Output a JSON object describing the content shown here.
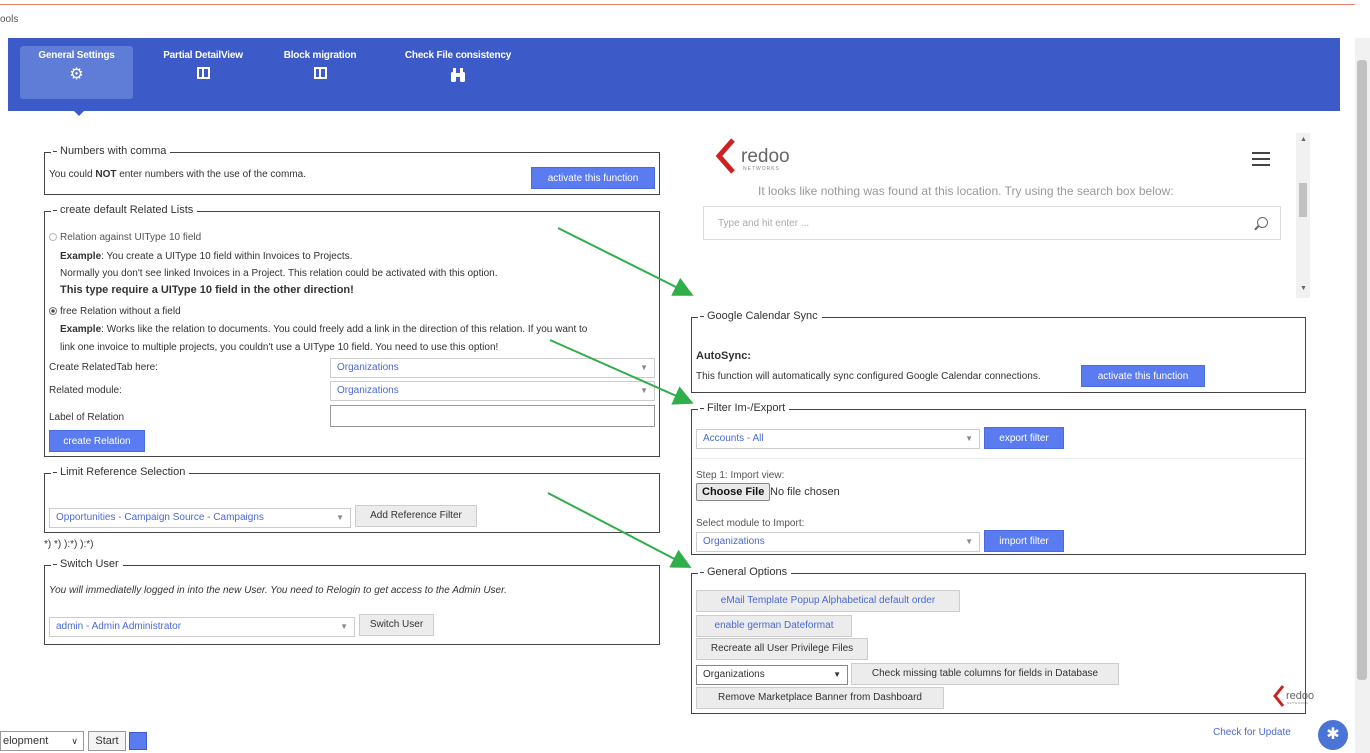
{
  "breadcrumb": "ools",
  "nav": {
    "tabs": [
      {
        "label": "General Settings",
        "icon": "gears-icon",
        "active": true
      },
      {
        "label": "Partial DetailView",
        "icon": "columns-icon",
        "active": false
      },
      {
        "label": "Block migration",
        "icon": "columns-icon",
        "active": false
      },
      {
        "label": "Check File consistency",
        "icon": "binoculars-icon",
        "active": false
      }
    ]
  },
  "numbers_comma": {
    "legend": "Numbers with comma",
    "text_pre": "You could ",
    "text_bold": "NOT",
    "text_post": " enter numbers with the use of the comma.",
    "button": "activate this function"
  },
  "related_lists": {
    "legend": "create default Related Lists",
    "option1_label": "Relation against UIType 10 field",
    "ex1_title": "Example",
    "ex1_line1": ": You create a UIType 10 field within Invoices to Projects.",
    "ex1_line2": "Normally you don't see linked Invoices in a Project. This relation could be activated with this option.",
    "ex1_line3": "This type require a UIType 10 field in the other direction!",
    "option2_label": "free Relation without a field",
    "ex2_title": "Example",
    "ex2_line1": ": Works like the relation to documents. You could freely add a link in the direction of this relation. If you want to",
    "ex2_line2": "link one invoice to multiple projects, you couldn't use a UIType 10 field. You need to use this option!",
    "tab_label": "Create RelatedTab here:",
    "tab_value": "Organizations",
    "module_label": "Related module:",
    "module_value": "Organizations",
    "relation_label": "Label of Relation",
    "button": "create Relation"
  },
  "limit_ref": {
    "legend": "Limit Reference Selection",
    "select_value": "Opportunities - Campaign Source - Campaigns",
    "button": "Add Reference Filter"
  },
  "stray_text": "*) *) ):*) ):*)",
  "switch_user": {
    "legend": "Switch User",
    "text": "You will immediatelly logged in into the new User. You need to Relogin to get access to the Admin User.",
    "select_value": "admin - Admin Administrator",
    "button": "Switch User"
  },
  "embedded": {
    "logo": "redoo",
    "logo_sub": "NETWORKS",
    "not_found": "It looks like nothing was found at this location. Try using the search box below:",
    "search_placeholder": "Type and hit enter ..."
  },
  "gcal": {
    "legend": "Google Calendar Sync",
    "heading": "AutoSync:",
    "text": "This function will automatically sync configured Google Calendar connections.",
    "button": "activate this function"
  },
  "filter": {
    "legend": "Filter Im-/Export",
    "export_select": "Accounts - All",
    "export_button": "export filter",
    "step1_label": "Step 1: Import view:",
    "file_button": "Choose File",
    "file_status": "No file chosen",
    "module_label": "Select module to Import:",
    "module_select": "Organizations",
    "import_button": "import filter"
  },
  "general": {
    "legend": "General Options",
    "btn_email": "eMail Template Popup Alphabetical default order",
    "btn_german": "enable german Dateformat",
    "btn_privilege": "Recreate all User Privilege Files",
    "module_select": "Organizations",
    "btn_missing": "Check missing table columns for fields in Database",
    "btn_banner": "Remove Marketplace Banner from Dashboard"
  },
  "footer": {
    "env_select": "elopment",
    "start_button": "Start",
    "check_update": "Check for Update"
  },
  "colors": {
    "nav_bg": "#3d5bc8",
    "btn_blue": "#5b7cf0",
    "link_blue": "#4a69d6",
    "arrow_green": "#2fae4a",
    "logo_red": "#cc2222"
  }
}
